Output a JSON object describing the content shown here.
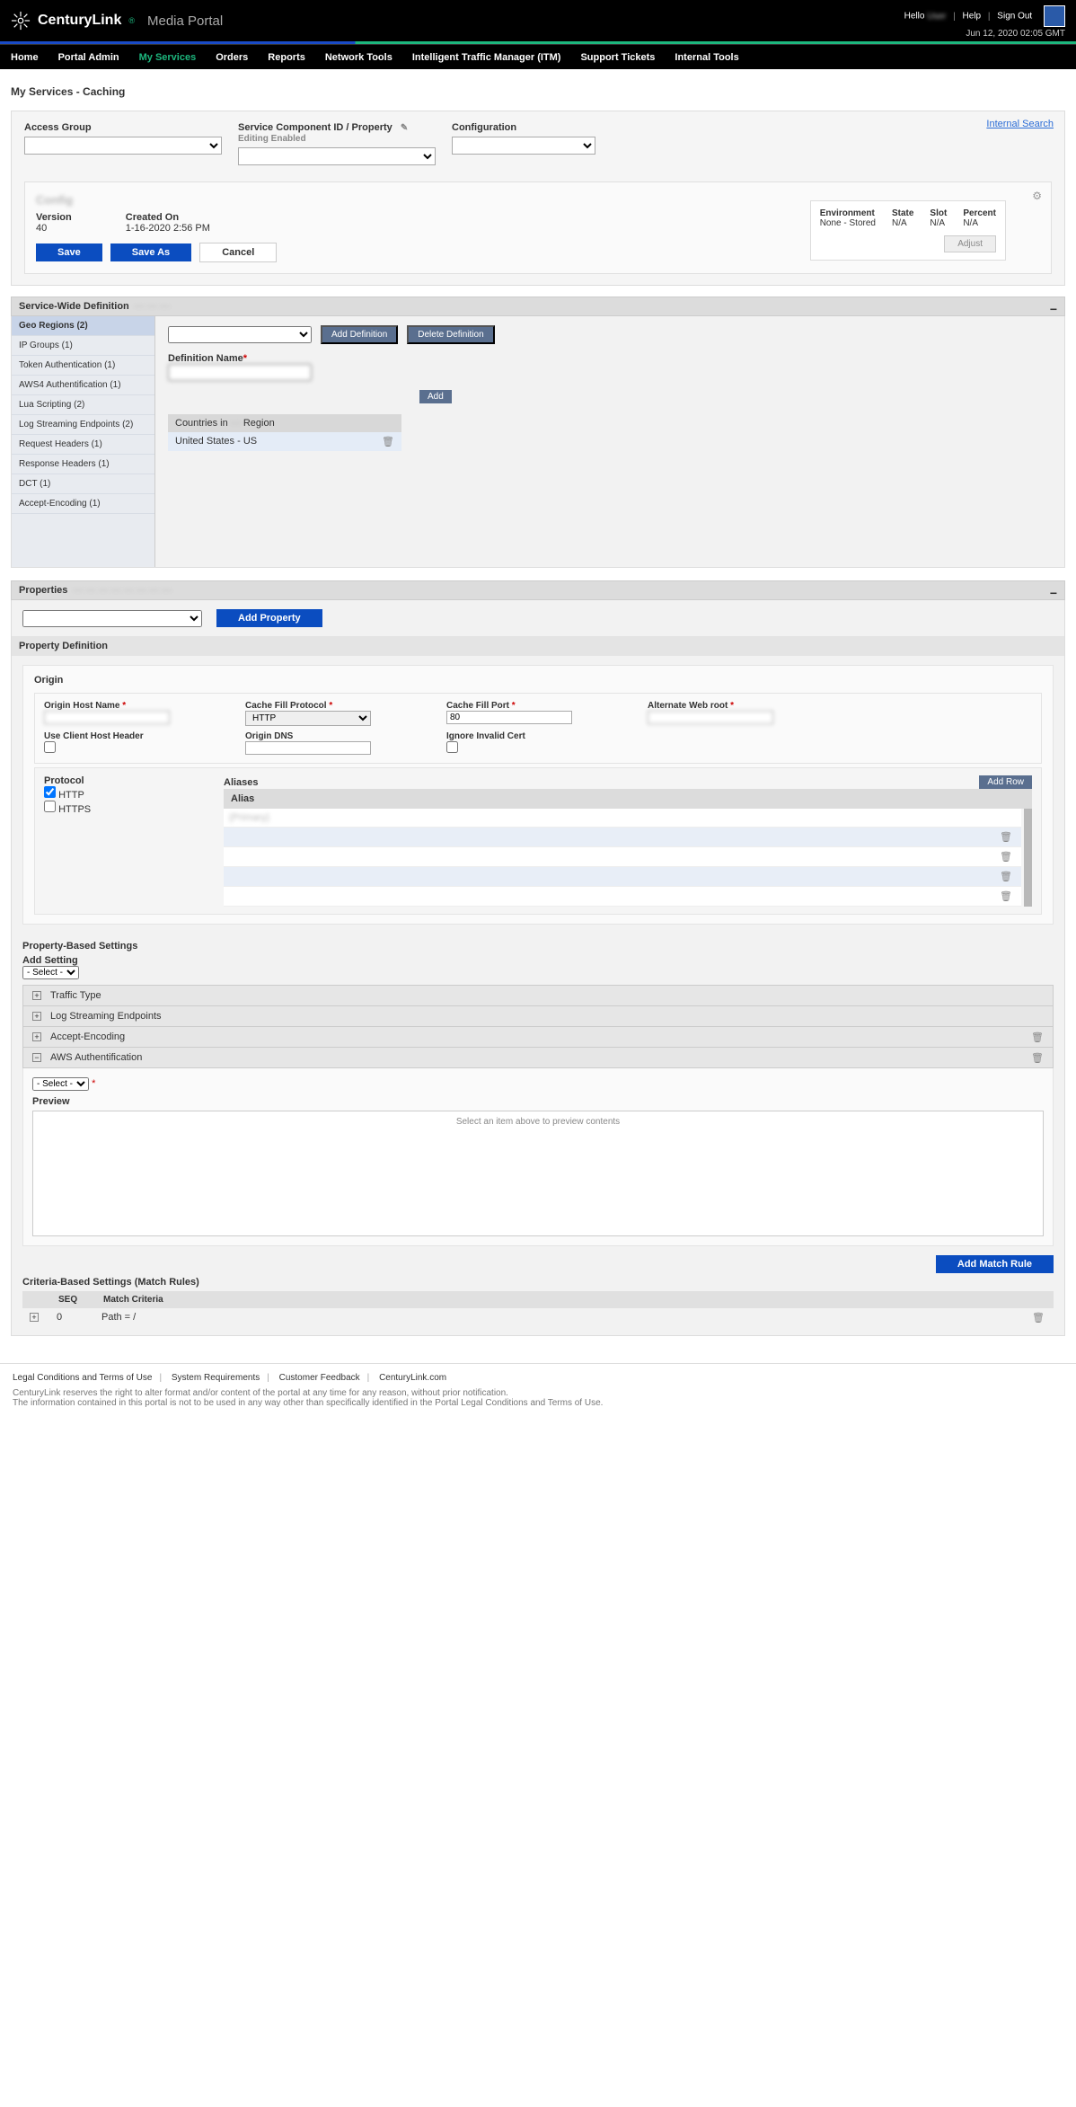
{
  "header": {
    "brand": "CenturyLink",
    "portal": "Media Portal",
    "hello": "Hello",
    "user": "User",
    "help": "Help",
    "sign_out": "Sign Out",
    "timestamp": "Jun 12, 2020 02:05 GMT"
  },
  "nav": {
    "home": "Home",
    "portal_admin": "Portal Admin",
    "my_services": "My Services",
    "orders": "Orders",
    "reports": "Reports",
    "network_tools": "Network Tools",
    "itm": "Intelligent Traffic Manager (ITM)",
    "tickets": "Support Tickets",
    "internal": "Internal Tools"
  },
  "page": {
    "title": "My Services - Caching",
    "internal_search": "Internal Search"
  },
  "filters": {
    "access_group_lbl": "Access Group",
    "access_group_val": "",
    "scid_lbl": "Service Component ID / Property",
    "editing": "Editing Enabled",
    "scid_val": "",
    "config_lbl": "Configuration",
    "config_val": ""
  },
  "summary": {
    "name": "Config",
    "version_lbl": "Version",
    "version_val": "40",
    "created_lbl": "Created On",
    "created_val": "1-16-2020 2:56 PM",
    "save": "Save",
    "save_as": "Save As",
    "cancel": "Cancel",
    "env_lbl": "Environment",
    "env_val": "None - Stored",
    "state_lbl": "State",
    "state_val": "N/A",
    "slot_lbl": "Slot",
    "slot_val": "N/A",
    "percent_lbl": "Percent",
    "percent_val": "N/A",
    "adjust": "Adjust"
  },
  "swd": {
    "header": "Service-Wide Definition",
    "tabs": {
      "geo": "Geo Regions (2)",
      "ip": "IP Groups (1)",
      "token": "Token Authentication (1)",
      "aws4": "AWS4 Authentification (1)",
      "lua": "Lua Scripting (2)",
      "log": "Log Streaming Endpoints (2)",
      "req": "Request Headers (1)",
      "resp": "Response Headers (1)",
      "dct": "DCT (1)",
      "enc": "Accept-Encoding (1)"
    },
    "select_val": "",
    "add_def": "Add Definition",
    "del_def": "Delete Definition",
    "def_name_lbl": "Definition Name",
    "def_name_val": "",
    "add": "Add",
    "countries_in": "Countries in",
    "region": "Region",
    "country_row": "United States - US"
  },
  "props": {
    "header": "Properties",
    "add_property": "Add Property",
    "prop_def": "Property Definition",
    "origin_hdr": "Origin",
    "ohn": "Origin Host Name",
    "cfp": "Cache Fill Protocol",
    "cfp_val": "HTTP",
    "cfport": "Cache Fill Port",
    "cfport_val": "80",
    "awr": "Alternate Web root",
    "uchh": "Use Client Host Header",
    "odns": "Origin DNS",
    "iic": "Ignore Invalid Cert",
    "protocol": "Protocol",
    "http": "HTTP",
    "https": "HTTPS",
    "aliases": "Aliases",
    "add_row": "Add Row",
    "alias_hdr": "Alias",
    "aliases_rows": [
      "(Primary)",
      "",
      "",
      "",
      ""
    ],
    "pbs": "Property-Based Settings",
    "add_setting": "Add Setting",
    "select_ph": "- Select -",
    "settings": {
      "traffic": "Traffic Type",
      "log": "Log Streaming Endpoints",
      "enc": "Accept-Encoding",
      "aws": "AWS Authentification"
    },
    "preview_lbl": "Preview",
    "preview_msg": "Select an item above to preview contents",
    "cbs": "Criteria-Based Settings (Match Rules)",
    "add_match": "Add Match Rule",
    "seq": "SEQ",
    "match_criteria": "Match Criteria",
    "rule_seq": "0",
    "rule_match": "Path = /"
  },
  "footer": {
    "legal": "Legal Conditions and Terms of Use",
    "sysreq": "System Requirements",
    "feedback": "Customer Feedback",
    "cl": "CenturyLink.com",
    "line1": "CenturyLink reserves the right to alter format and/or content of the portal at any time for any reason, without prior notification.",
    "line2": "The information contained in this portal is not to be used in any way other than specifically identified in the Portal Legal Conditions and Terms of Use."
  }
}
